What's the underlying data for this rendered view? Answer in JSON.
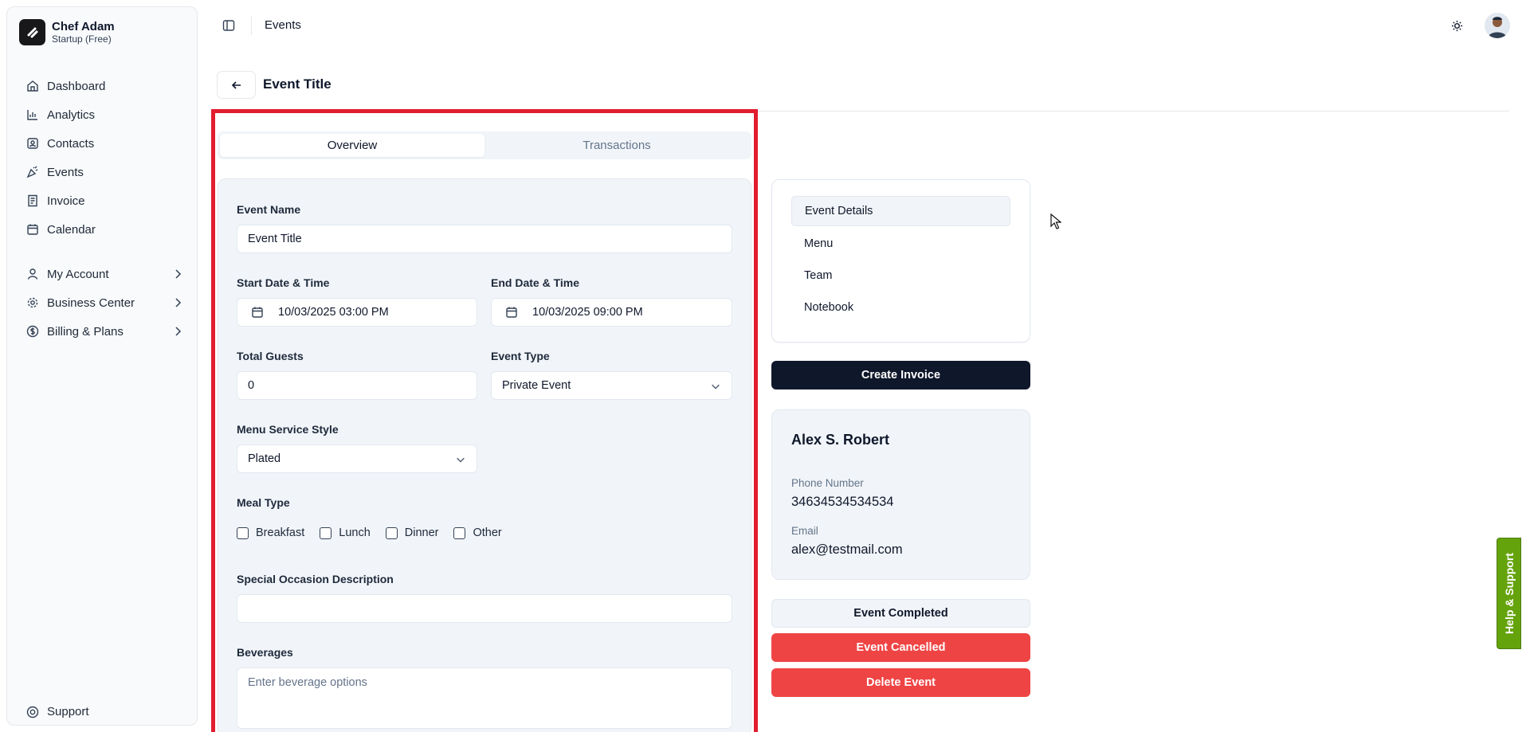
{
  "sidebar": {
    "brand_name": "Chef Adam",
    "brand_plan": "Startup (Free)",
    "items": [
      {
        "label": "Dashboard",
        "icon": "home-icon"
      },
      {
        "label": "Analytics",
        "icon": "bar-chart-icon"
      },
      {
        "label": "Contacts",
        "icon": "contact-icon"
      },
      {
        "label": "Events",
        "icon": "party-icon"
      },
      {
        "label": "Invoice",
        "icon": "receipt-icon"
      },
      {
        "label": "Calendar",
        "icon": "calendar-icon"
      }
    ],
    "groups": [
      {
        "label": "My Account",
        "icon": "user-icon"
      },
      {
        "label": "Business Center",
        "icon": "gear-icon"
      },
      {
        "label": "Billing & Plans",
        "icon": "dollar-circle-icon"
      }
    ],
    "support_label": "Support"
  },
  "topbar": {
    "title": "Events"
  },
  "page": {
    "title": "Event Title"
  },
  "tabs": [
    {
      "label": "Overview",
      "active": true
    },
    {
      "label": "Transactions",
      "active": false
    }
  ],
  "form": {
    "event_name_label": "Event Name",
    "event_name_value": "Event Title",
    "start_label": "Start Date & Time",
    "start_value": "10/03/2025 03:00 PM",
    "end_label": "End Date & Time",
    "end_value": "10/03/2025 09:00 PM",
    "guests_label": "Total Guests",
    "guests_value": "0",
    "event_type_label": "Event Type",
    "event_type_value": "Private Event",
    "service_style_label": "Menu Service Style",
    "service_style_value": "Plated",
    "meal_type_label": "Meal Type",
    "meal_types": [
      "Breakfast",
      "Lunch",
      "Dinner",
      "Other"
    ],
    "occasion_label": "Special Occasion Description",
    "occasion_value": "",
    "beverages_label": "Beverages",
    "beverages_placeholder": "Enter beverage options"
  },
  "details_nav": [
    "Event Details",
    "Menu",
    "Team",
    "Notebook"
  ],
  "actions": {
    "create_invoice": "Create Invoice",
    "completed": "Event Completed",
    "cancelled": "Event Cancelled",
    "delete": "Delete Event"
  },
  "contact": {
    "name": "Alex S. Robert",
    "phone_label": "Phone Number",
    "phone": "34634534534534",
    "email_label": "Email",
    "email": "alex@testmail.com"
  },
  "help_label": "Help & Support",
  "colors": {
    "highlight": "#e11d2e",
    "danger": "#ef4444",
    "primary_dark": "#0f172a",
    "help_green": "#65a30d"
  }
}
